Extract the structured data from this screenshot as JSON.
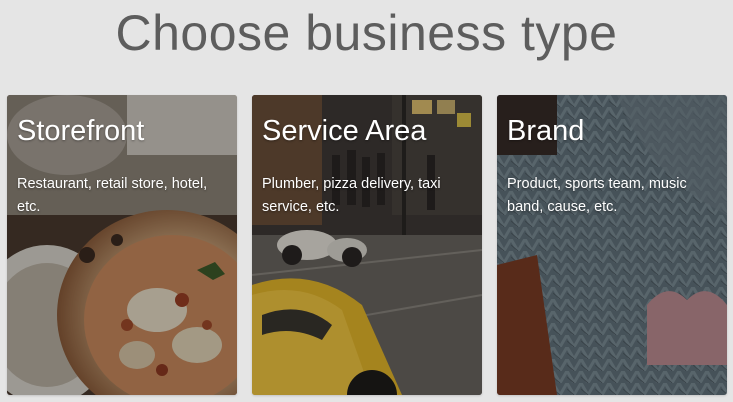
{
  "page": {
    "title": "Choose business type"
  },
  "cards": [
    {
      "title": "Storefront",
      "description": "Restaurant, retail store, hotel, etc.",
      "image": "pizza-photo"
    },
    {
      "title": "Service Area",
      "description": "Plumber, pizza delivery, taxi service, etc.",
      "image": "street-taxi-photo"
    },
    {
      "title": "Brand",
      "description": "Product, sports team, music band, cause, etc.",
      "image": "knit-sweater-photo"
    }
  ],
  "colors": {
    "background": "#e5e5e5",
    "title_text": "#5d5d5d",
    "card_text": "#ffffff"
  }
}
